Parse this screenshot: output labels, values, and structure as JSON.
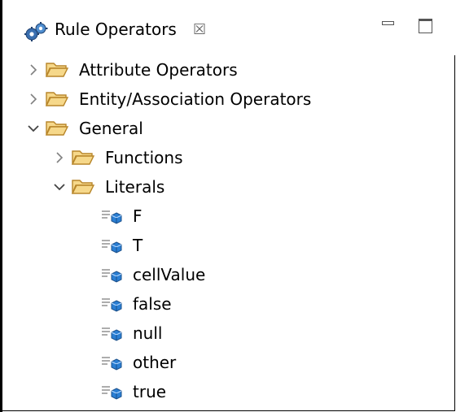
{
  "view": {
    "title": "Rule Operators",
    "close_glyph": "☒",
    "icon": "rule-operators-icon"
  },
  "tree": {
    "items": [
      {
        "label": "Attribute Operators",
        "expanded": false,
        "icon": "folder-icon"
      },
      {
        "label": "Entity/Association Operators",
        "expanded": false,
        "icon": "folder-icon"
      },
      {
        "label": "General",
        "expanded": true,
        "icon": "folder-icon"
      },
      {
        "label": "Functions",
        "expanded": false,
        "icon": "folder-icon"
      },
      {
        "label": "Literals",
        "expanded": true,
        "icon": "folder-icon"
      },
      {
        "label": "F",
        "icon": "literal-icon"
      },
      {
        "label": "T",
        "icon": "literal-icon"
      },
      {
        "label": "cellValue",
        "icon": "literal-icon"
      },
      {
        "label": "false",
        "icon": "literal-icon"
      },
      {
        "label": "null",
        "icon": "literal-icon"
      },
      {
        "label": "other",
        "icon": "literal-icon"
      },
      {
        "label": "true",
        "icon": "literal-icon"
      }
    ]
  },
  "colors": {
    "folder_fill": "#f6d88a",
    "folder_stroke": "#b8862a",
    "literal_blue": "#2a7fd4",
    "chevron": "#808080"
  }
}
